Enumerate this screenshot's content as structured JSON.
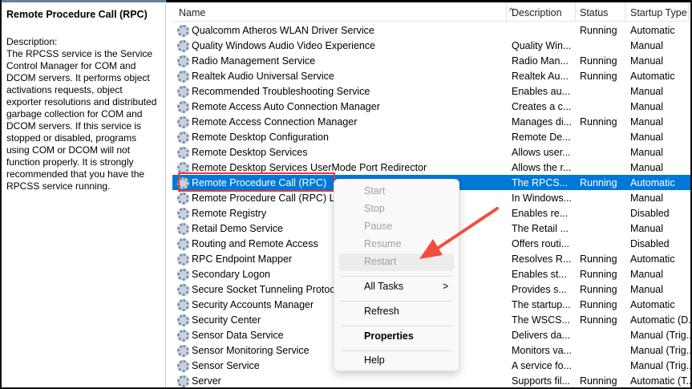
{
  "left_panel": {
    "title": "Remote Procedure Call (RPC)",
    "description": "Description:\nThe RPCSS service is the Service Control Manager for COM and DCOM servers. It performs object activations requests, object exporter resolutions and distributed garbage collection for COM and DCOM servers. If this service is stopped or disabled, programs using COM or DCOM will not function properly. It is strongly recommended that you have the RPCSS service running."
  },
  "columns": {
    "name": "Name",
    "description": "Description",
    "status": "Status",
    "startup": "Startup Type"
  },
  "rows": [
    {
      "name": "Qualcomm Atheros WLAN Driver Service",
      "desc": "",
      "status": "Running",
      "startup": "Automatic"
    },
    {
      "name": "Quality Windows Audio Video Experience",
      "desc": "Quality Win...",
      "status": "",
      "startup": "Manual"
    },
    {
      "name": "Radio Management Service",
      "desc": "Radio Man...",
      "status": "Running",
      "startup": "Manual"
    },
    {
      "name": "Realtek Audio Universal Service",
      "desc": "Realtek Au...",
      "status": "Running",
      "startup": "Automatic"
    },
    {
      "name": "Recommended Troubleshooting Service",
      "desc": "Enables au...",
      "status": "",
      "startup": "Manual"
    },
    {
      "name": "Remote Access Auto Connection Manager",
      "desc": "Creates a c...",
      "status": "",
      "startup": "Manual"
    },
    {
      "name": "Remote Access Connection Manager",
      "desc": "Manages di...",
      "status": "Running",
      "startup": "Manual"
    },
    {
      "name": "Remote Desktop Configuration",
      "desc": "Remote De...",
      "status": "",
      "startup": "Manual"
    },
    {
      "name": "Remote Desktop Services",
      "desc": "Allows user...",
      "status": "",
      "startup": "Manual"
    },
    {
      "name": "Remote Desktop Services UserMode Port Redirector",
      "desc": "Allows the r...",
      "status": "",
      "startup": "Manual"
    },
    {
      "name": "Remote Procedure Call (RPC)",
      "desc": "The RPCS...",
      "status": "Running",
      "startup": "Automatic"
    },
    {
      "name": "Remote Procedure Call (RPC) Locator",
      "desc": "In Windows...",
      "status": "",
      "startup": "Manual"
    },
    {
      "name": "Remote Registry",
      "desc": "Enables re...",
      "status": "",
      "startup": "Disabled"
    },
    {
      "name": "Retail Demo Service",
      "desc": "The Retail ...",
      "status": "",
      "startup": "Manual"
    },
    {
      "name": "Routing and Remote Access",
      "desc": "Offers routi...",
      "status": "",
      "startup": "Disabled"
    },
    {
      "name": "RPC Endpoint Mapper",
      "desc": "Resolves R...",
      "status": "Running",
      "startup": "Automatic"
    },
    {
      "name": "Secondary Logon",
      "desc": "Enables st...",
      "status": "Running",
      "startup": "Manual"
    },
    {
      "name": "Secure Socket Tunneling Protocol Service",
      "desc": "Provides s...",
      "status": "Running",
      "startup": "Manual"
    },
    {
      "name": "Security Accounts Manager",
      "desc": "The startup...",
      "status": "Running",
      "startup": "Automatic"
    },
    {
      "name": "Security Center",
      "desc": "The WSCS...",
      "status": "Running",
      "startup": "Automatic (D..."
    },
    {
      "name": "Sensor Data Service",
      "desc": "Delivers da...",
      "status": "",
      "startup": "Manual (Trig..."
    },
    {
      "name": "Sensor Monitoring Service",
      "desc": "Monitors va...",
      "status": "",
      "startup": "Manual (Trig..."
    },
    {
      "name": "Sensor Service",
      "desc": "A service fo...",
      "status": "",
      "startup": "Manual (Trig..."
    },
    {
      "name": "Server",
      "desc": "Supports fil...",
      "status": "Running",
      "startup": "Automatic (T..."
    }
  ],
  "selected_index": 10,
  "context_menu": {
    "start": "Start",
    "stop": "Stop",
    "pause": "Pause",
    "resume": "Resume",
    "restart": "Restart",
    "all_tasks": "All Tasks",
    "submenu_arrow": ">",
    "refresh": "Refresh",
    "properties": "Properties",
    "help": "Help"
  },
  "colors": {
    "selection": "#0078d7",
    "annotation": "#e53935"
  }
}
